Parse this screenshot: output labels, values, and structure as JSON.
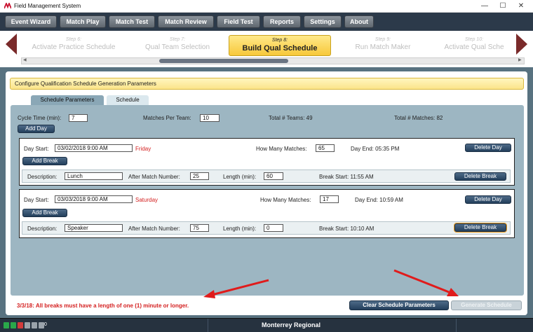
{
  "window": {
    "title": "Field Management System",
    "minimize": "—",
    "maximize": "☐",
    "close": "✕"
  },
  "menu": {
    "items": [
      "Event Wizard",
      "Match Play",
      "Match Test",
      "Match Review",
      "Field Test",
      "Reports",
      "Settings",
      "About"
    ]
  },
  "steps": [
    {
      "num": "Step 6:",
      "label": "Activate Practice Schedule"
    },
    {
      "num": "Step 7:",
      "label": "Qual Team Selection"
    },
    {
      "num": "Step 8:",
      "label": "Build Qual Schedule"
    },
    {
      "num": "Step 9:",
      "label": "Run Match Maker"
    },
    {
      "num": "Step 10:",
      "label": "Activate Qual Sche"
    }
  ],
  "header": {
    "title": "Configure Qualification Schedule Generation Parameters"
  },
  "tabs": [
    "Schedule Parameters",
    "Schedule"
  ],
  "params": {
    "cycle_label": "Cycle Time (min):",
    "cycle_value": "7",
    "mpt_label": "Matches Per Team:",
    "mpt_value": "10",
    "total_teams": "Total # Teams: 49",
    "total_matches": "Total # Matches: 82",
    "add_day": "Add Day"
  },
  "days": [
    {
      "start_label": "Day Start:",
      "start_value": "03/02/2018 9:00 AM",
      "weekday": "Friday",
      "hm_label": "How Many Matches:",
      "hm_value": "65",
      "end": "Day End:  05:35 PM",
      "delete_day": "Delete Day",
      "add_break": "Add Break",
      "break": {
        "desc_label": "Description:",
        "desc_value": "Lunch",
        "amn_label": "After Match Number:",
        "amn_value": "25",
        "len_label": "Length (min):",
        "len_value": "60",
        "start": "Break Start:  11:55 AM",
        "delete_break": "Delete Break"
      }
    },
    {
      "start_label": "Day Start:",
      "start_value": "03/03/2018 9:00 AM",
      "weekday": "Saturday",
      "hm_label": "How Many Matches:",
      "hm_value": "17",
      "end": "Day End:  10:59 AM",
      "delete_day": "Delete Day",
      "add_break": "Add Break",
      "break": {
        "desc_label": "Description:",
        "desc_value": "Speaker",
        "amn_label": "After Match Number:",
        "amn_value": "75",
        "len_label": "Length (min):",
        "len_value": "0",
        "start": "Break Start:  10:10 AM",
        "delete_break": "Delete Break"
      }
    }
  ],
  "footer": {
    "error": "3/3/18: All breaks must have a length of one (1) minute or longer.",
    "clear": "Clear Schedule Parameters",
    "generate": "Generate Schedule"
  },
  "status": {
    "region": "Monterrey Regional",
    "count": "0",
    "indicator_colors": [
      "#2aa84a",
      "#2aa84a",
      "#d23b3b",
      "#9aa3ab"
    ]
  },
  "colors": {
    "accent_yellow": "#f7c83a",
    "error_red": "#d42020",
    "button_blue": "#233f5c",
    "annotation_arrow": "#e01b1b"
  }
}
